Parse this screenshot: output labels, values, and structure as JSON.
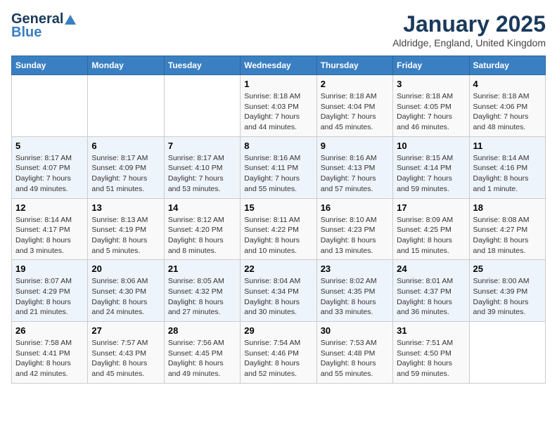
{
  "logo": {
    "general": "General",
    "blue": "Blue"
  },
  "title": "January 2025",
  "location": "Aldridge, England, United Kingdom",
  "days_of_week": [
    "Sunday",
    "Monday",
    "Tuesday",
    "Wednesday",
    "Thursday",
    "Friday",
    "Saturday"
  ],
  "weeks": [
    [
      {
        "day": "",
        "sunrise": "",
        "sunset": "",
        "daylight": ""
      },
      {
        "day": "",
        "sunrise": "",
        "sunset": "",
        "daylight": ""
      },
      {
        "day": "",
        "sunrise": "",
        "sunset": "",
        "daylight": ""
      },
      {
        "day": "1",
        "sunrise": "Sunrise: 8:18 AM",
        "sunset": "Sunset: 4:03 PM",
        "daylight": "Daylight: 7 hours and 44 minutes."
      },
      {
        "day": "2",
        "sunrise": "Sunrise: 8:18 AM",
        "sunset": "Sunset: 4:04 PM",
        "daylight": "Daylight: 7 hours and 45 minutes."
      },
      {
        "day": "3",
        "sunrise": "Sunrise: 8:18 AM",
        "sunset": "Sunset: 4:05 PM",
        "daylight": "Daylight: 7 hours and 46 minutes."
      },
      {
        "day": "4",
        "sunrise": "Sunrise: 8:18 AM",
        "sunset": "Sunset: 4:06 PM",
        "daylight": "Daylight: 7 hours and 48 minutes."
      }
    ],
    [
      {
        "day": "5",
        "sunrise": "Sunrise: 8:17 AM",
        "sunset": "Sunset: 4:07 PM",
        "daylight": "Daylight: 7 hours and 49 minutes."
      },
      {
        "day": "6",
        "sunrise": "Sunrise: 8:17 AM",
        "sunset": "Sunset: 4:09 PM",
        "daylight": "Daylight: 7 hours and 51 minutes."
      },
      {
        "day": "7",
        "sunrise": "Sunrise: 8:17 AM",
        "sunset": "Sunset: 4:10 PM",
        "daylight": "Daylight: 7 hours and 53 minutes."
      },
      {
        "day": "8",
        "sunrise": "Sunrise: 8:16 AM",
        "sunset": "Sunset: 4:11 PM",
        "daylight": "Daylight: 7 hours and 55 minutes."
      },
      {
        "day": "9",
        "sunrise": "Sunrise: 8:16 AM",
        "sunset": "Sunset: 4:13 PM",
        "daylight": "Daylight: 7 hours and 57 minutes."
      },
      {
        "day": "10",
        "sunrise": "Sunrise: 8:15 AM",
        "sunset": "Sunset: 4:14 PM",
        "daylight": "Daylight: 7 hours and 59 minutes."
      },
      {
        "day": "11",
        "sunrise": "Sunrise: 8:14 AM",
        "sunset": "Sunset: 4:16 PM",
        "daylight": "Daylight: 8 hours and 1 minute."
      }
    ],
    [
      {
        "day": "12",
        "sunrise": "Sunrise: 8:14 AM",
        "sunset": "Sunset: 4:17 PM",
        "daylight": "Daylight: 8 hours and 3 minutes."
      },
      {
        "day": "13",
        "sunrise": "Sunrise: 8:13 AM",
        "sunset": "Sunset: 4:19 PM",
        "daylight": "Daylight: 8 hours and 5 minutes."
      },
      {
        "day": "14",
        "sunrise": "Sunrise: 8:12 AM",
        "sunset": "Sunset: 4:20 PM",
        "daylight": "Daylight: 8 hours and 8 minutes."
      },
      {
        "day": "15",
        "sunrise": "Sunrise: 8:11 AM",
        "sunset": "Sunset: 4:22 PM",
        "daylight": "Daylight: 8 hours and 10 minutes."
      },
      {
        "day": "16",
        "sunrise": "Sunrise: 8:10 AM",
        "sunset": "Sunset: 4:23 PM",
        "daylight": "Daylight: 8 hours and 13 minutes."
      },
      {
        "day": "17",
        "sunrise": "Sunrise: 8:09 AM",
        "sunset": "Sunset: 4:25 PM",
        "daylight": "Daylight: 8 hours and 15 minutes."
      },
      {
        "day": "18",
        "sunrise": "Sunrise: 8:08 AM",
        "sunset": "Sunset: 4:27 PM",
        "daylight": "Daylight: 8 hours and 18 minutes."
      }
    ],
    [
      {
        "day": "19",
        "sunrise": "Sunrise: 8:07 AM",
        "sunset": "Sunset: 4:29 PM",
        "daylight": "Daylight: 8 hours and 21 minutes."
      },
      {
        "day": "20",
        "sunrise": "Sunrise: 8:06 AM",
        "sunset": "Sunset: 4:30 PM",
        "daylight": "Daylight: 8 hours and 24 minutes."
      },
      {
        "day": "21",
        "sunrise": "Sunrise: 8:05 AM",
        "sunset": "Sunset: 4:32 PM",
        "daylight": "Daylight: 8 hours and 27 minutes."
      },
      {
        "day": "22",
        "sunrise": "Sunrise: 8:04 AM",
        "sunset": "Sunset: 4:34 PM",
        "daylight": "Daylight: 8 hours and 30 minutes."
      },
      {
        "day": "23",
        "sunrise": "Sunrise: 8:02 AM",
        "sunset": "Sunset: 4:35 PM",
        "daylight": "Daylight: 8 hours and 33 minutes."
      },
      {
        "day": "24",
        "sunrise": "Sunrise: 8:01 AM",
        "sunset": "Sunset: 4:37 PM",
        "daylight": "Daylight: 8 hours and 36 minutes."
      },
      {
        "day": "25",
        "sunrise": "Sunrise: 8:00 AM",
        "sunset": "Sunset: 4:39 PM",
        "daylight": "Daylight: 8 hours and 39 minutes."
      }
    ],
    [
      {
        "day": "26",
        "sunrise": "Sunrise: 7:58 AM",
        "sunset": "Sunset: 4:41 PM",
        "daylight": "Daylight: 8 hours and 42 minutes."
      },
      {
        "day": "27",
        "sunrise": "Sunrise: 7:57 AM",
        "sunset": "Sunset: 4:43 PM",
        "daylight": "Daylight: 8 hours and 45 minutes."
      },
      {
        "day": "28",
        "sunrise": "Sunrise: 7:56 AM",
        "sunset": "Sunset: 4:45 PM",
        "daylight": "Daylight: 8 hours and 49 minutes."
      },
      {
        "day": "29",
        "sunrise": "Sunrise: 7:54 AM",
        "sunset": "Sunset: 4:46 PM",
        "daylight": "Daylight: 8 hours and 52 minutes."
      },
      {
        "day": "30",
        "sunrise": "Sunrise: 7:53 AM",
        "sunset": "Sunset: 4:48 PM",
        "daylight": "Daylight: 8 hours and 55 minutes."
      },
      {
        "day": "31",
        "sunrise": "Sunrise: 7:51 AM",
        "sunset": "Sunset: 4:50 PM",
        "daylight": "Daylight: 8 hours and 59 minutes."
      },
      {
        "day": "",
        "sunrise": "",
        "sunset": "",
        "daylight": ""
      }
    ]
  ]
}
